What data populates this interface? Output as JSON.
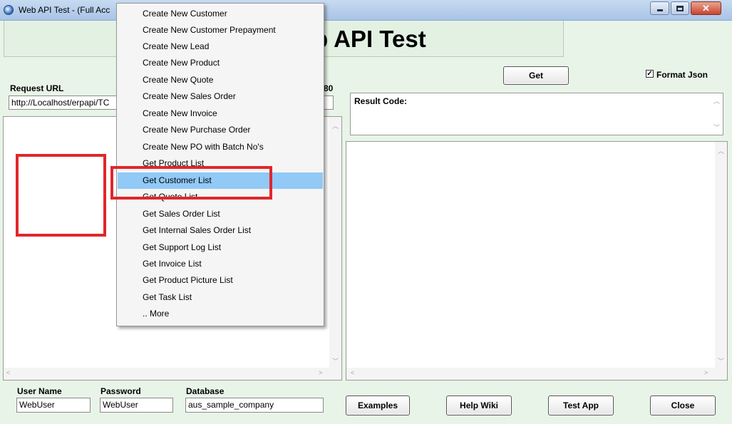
{
  "window": {
    "title": "Web API Test - (Full Acc",
    "controls": {
      "minimize": "minimize",
      "maximize": "maximize",
      "close": "close"
    }
  },
  "banner": {
    "title": "b API Test"
  },
  "request": {
    "url_label": "Request URL",
    "url_value": "http://Localhost/erpapi/TC",
    "port_fragment": "80"
  },
  "top_right": {
    "get_label": "Get",
    "format_json_label": "Format Json",
    "format_json_checked": true,
    "result_code_label": "Result Code:"
  },
  "bottom": {
    "username_label": "User Name",
    "username_value": "WebUser",
    "password_label": "Password",
    "password_value": "WebUser",
    "database_label": "Database",
    "database_value": "aus_sample_company",
    "examples_label": "Examples",
    "help_wiki_label": "Help Wiki",
    "test_app_label": "Test App",
    "close_label": "Close"
  },
  "menu": {
    "items": [
      "Create New Customer",
      "Create New Customer Prepayment",
      "Create New Lead",
      "Create New Product",
      "Create New Quote",
      "Create New Sales Order",
      "Create New Invoice",
      "Create New Purchase Order",
      "Create New PO with Batch No's",
      "Get Product List",
      "Get Customer List",
      "Get Quote List",
      "Get Sales Order List",
      "Get Internal Sales Order List",
      "Get Support Log List",
      "Get Invoice List",
      "Get Product Picture List",
      "Get Task List",
      ".. More"
    ],
    "selected_index": 10
  },
  "colors": {
    "background": "#e9f4e8",
    "menu_highlight": "#91c9f7",
    "annotation_red": "#e0272b"
  }
}
